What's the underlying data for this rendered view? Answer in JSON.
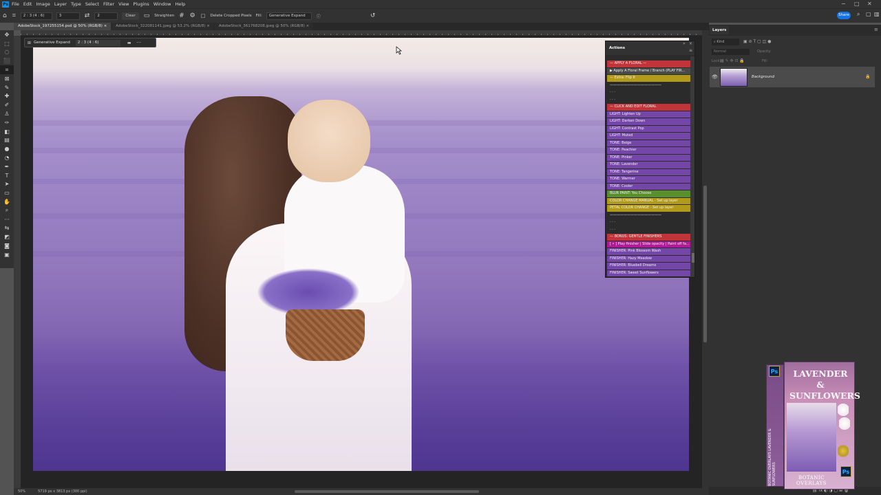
{
  "menubar": {
    "logo": "Ps",
    "items": [
      "File",
      "Edit",
      "Image",
      "Layer",
      "Type",
      "Select",
      "Filter",
      "View",
      "Plugins",
      "Window",
      "Help"
    ],
    "window_controls": [
      "−",
      "□",
      "✕"
    ]
  },
  "options_bar": {
    "ratio": "2 : 3 (4 : 6)",
    "width_value": "3",
    "height_value": "2",
    "clear_label": "Clear",
    "straighten_label": "Straighten",
    "delete_cropped_label": "Delete Cropped Pixels",
    "fill_label": "Fill:",
    "fill_value": "Generative Expand",
    "share_label": "Share"
  },
  "tabs": [
    {
      "label": "AdobeStock_197255154.psd @ 50% (RGB/8)",
      "active": true
    },
    {
      "label": "AdobeStock_322081141.jpeg @ 53.2% (RGB/8)",
      "active": false
    },
    {
      "label": "AdobeStock_361768208.jpeg @ 50% (RGB/8)",
      "active": false
    }
  ],
  "generative_expand": {
    "label": "Generative Expand",
    "ratio": "2 : 3 (4 : 6)"
  },
  "actions_panel": {
    "title": "Actions",
    "rows": [
      {
        "label": "— APPLY A FLORAL —",
        "color": "#c0343a"
      },
      {
        "label": "▶  Apply A Floral Frame / Branch (PLAY FIR...",
        "color": "#4a4a4a"
      },
      {
        "label": "— Extra: Flip It",
        "color": "#b29a1a"
      },
      {
        "label": "———————————————",
        "color": "#2b2b2b"
      },
      {
        "label": "· · ·",
        "color": "#2b2b2b"
      },
      {
        "label": "· · ·",
        "color": "#2b2b2b"
      },
      {
        "label": "— CLICK AND EDIT FLORAL",
        "color": "#c0343a"
      },
      {
        "label": "LIGHT: Lighten Up",
        "color": "#7446a8"
      },
      {
        "label": "LIGHT: Darken Down",
        "color": "#7446a8"
      },
      {
        "label": "LIGHT: Contrast Pop",
        "color": "#7446a8"
      },
      {
        "label": "LIGHT: Muted",
        "color": "#7446a8"
      },
      {
        "label": "TONE: Beige",
        "color": "#7446a8"
      },
      {
        "label": "TONE: Peachier",
        "color": "#7446a8"
      },
      {
        "label": "TONE: Pinker",
        "color": "#7446a8"
      },
      {
        "label": "TONE: Lavender",
        "color": "#7446a8"
      },
      {
        "label": "TONE: Tangerine",
        "color": "#7446a8"
      },
      {
        "label": "TONE: Warmer",
        "color": "#7446a8"
      },
      {
        "label": "TONE: Cooler",
        "color": "#7446a8"
      },
      {
        "label": "BLUR PAINT: You Choose",
        "color": "#5a8f2e"
      },
      {
        "label": "COLOR CHANGE MANUAL - Set up layer",
        "color": "#b29a1a"
      },
      {
        "label": "PETAL COLOR CHANGE - Set up layer",
        "color": "#b29a1a"
      },
      {
        "label": "———————————————",
        "color": "#2b2b2b"
      },
      {
        "label": "· · ·",
        "color": "#2b2b2b"
      },
      {
        "label": "· · ·",
        "color": "#2b2b2b"
      },
      {
        "label": "— BONUS: GENTLE FINISHERS",
        "color": "#c0343a"
      },
      {
        "label": "[ • ] Play finisher | Slide opacity | Paint off fa...",
        "color": "#b01a96"
      },
      {
        "label": "FINISHER: Pink Blossom Wash",
        "color": "#7446a8"
      },
      {
        "label": "FINISHER: Hazy Meadow",
        "color": "#7446a8"
      },
      {
        "label": "FINISHER: Bluebell Dreams",
        "color": "#7446a8"
      },
      {
        "label": "FINISHER: Sweet Sunflowers",
        "color": "#7446a8"
      }
    ]
  },
  "layers_panel": {
    "tab": "Layers",
    "search_placeholder": "Kind",
    "blend_mode": "Normal",
    "opacity_label": "Opacity:",
    "lock_label": "Lock:",
    "fill_label": "Fill:",
    "layer_name": "Background"
  },
  "status_bar": {
    "zoom": "50%",
    "doc_info": "5719 px x 3813 px (300 ppi)"
  },
  "product_box": {
    "title": "LAVENDER & SUNFLOWERS",
    "brand": "BOTANIC OVERLAYS",
    "side_text": "BOTANIC OVERLAYS  LAVENDER & SUNFLOWERS",
    "ps_badge": "Ps"
  }
}
